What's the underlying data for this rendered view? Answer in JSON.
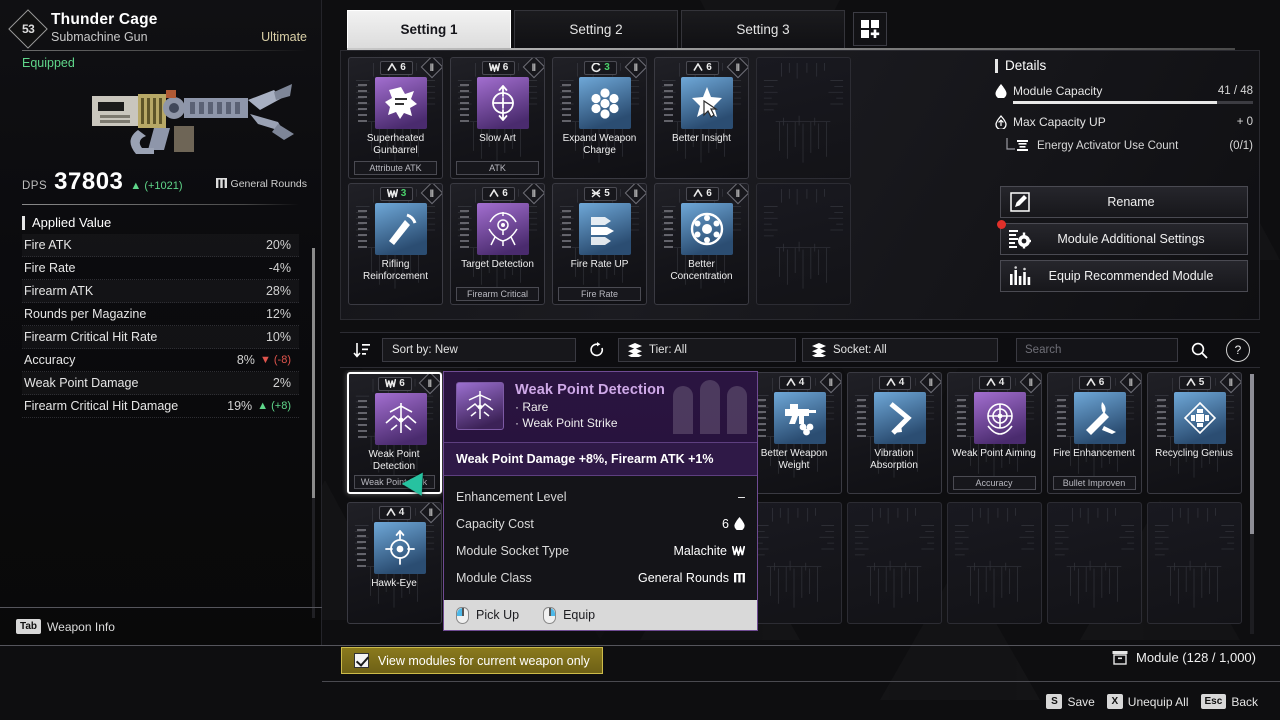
{
  "weapon": {
    "level": "53",
    "name": "Thunder Cage",
    "type": "Submachine Gun",
    "tier": "Ultimate",
    "status": "Equipped",
    "dps_label": "DPS",
    "dps_value": "37803",
    "dps_delta": "▲ (+1021)",
    "round_type": "General Rounds"
  },
  "applied": {
    "header": "Applied Value",
    "rows": [
      {
        "name": "Fire ATK",
        "value": "20%",
        "delta": "",
        "dir": ""
      },
      {
        "name": "Fire Rate",
        "value": "-4%",
        "delta": "",
        "dir": ""
      },
      {
        "name": "Firearm ATK",
        "value": "28%",
        "delta": "",
        "dir": ""
      },
      {
        "name": "Rounds per Magazine",
        "value": "12%",
        "delta": "",
        "dir": ""
      },
      {
        "name": "Firearm Critical Hit Rate",
        "value": "10%",
        "delta": "",
        "dir": ""
      },
      {
        "name": "Accuracy",
        "value": "8%",
        "delta": "▼ (-8)",
        "dir": "down"
      },
      {
        "name": "Weak Point Damage",
        "value": "2%",
        "delta": "",
        "dir": ""
      },
      {
        "name": "Firearm Critical Hit Damage",
        "value": "19%",
        "delta": "▲ (+8)",
        "dir": "up"
      }
    ]
  },
  "left_footer": {
    "key": "Tab",
    "label": "Weapon Info"
  },
  "tabs": {
    "items": [
      {
        "label": "Setting 1",
        "active": true
      },
      {
        "label": "Setting 2",
        "active": false
      },
      {
        "label": "Setting 3",
        "active": false
      }
    ],
    "add_tab_icon": "grid-plus-icon"
  },
  "equipped_modules": [
    {
      "cost": "6",
      "cost_icon": "chevron-socket-icon",
      "name": "Superheated Gunbarrel",
      "tag": "Attribute ATK",
      "icon": "burst-icon",
      "tone": "purple",
      "empty": false
    },
    {
      "cost": "6",
      "cost_icon": "malachite-socket-icon",
      "name": "Slow Art",
      "tag": "ATK",
      "icon": "crosshair-arrows-icon",
      "tone": "purple",
      "empty": false
    },
    {
      "cost": "3",
      "cost_icon": "cerulean-socket-icon",
      "name": "Expand Weapon Charge",
      "tag": "",
      "icon": "cylinder-icon",
      "tone": "blue",
      "empty": false,
      "cost_green": true
    },
    {
      "cost": "6",
      "cost_icon": "chevron-socket-icon",
      "name": "Better Insight",
      "tag": "",
      "icon": "star-cursor-icon",
      "tone": "blue",
      "empty": false
    },
    {
      "cost": "",
      "cost_icon": "",
      "name": "",
      "tag": "",
      "icon": "",
      "tone": "",
      "empty": true
    },
    {
      "cost": "3",
      "cost_icon": "malachite-socket-icon",
      "name": "Rifling Reinforcement",
      "tag": "",
      "icon": "bullet-streak-icon",
      "tone": "blue",
      "empty": false,
      "cost_green": true
    },
    {
      "cost": "6",
      "cost_icon": "chevron-socket-icon",
      "name": "Target Detection",
      "tag": "Firearm Critical",
      "icon": "target-emblem-icon",
      "tone": "purple",
      "empty": false
    },
    {
      "cost": "5",
      "cost_icon": "xantic-socket-icon",
      "name": "Fire Rate UP",
      "tag": "Fire Rate",
      "icon": "bullets-icon",
      "tone": "blue",
      "empty": false
    },
    {
      "cost": "6",
      "cost_icon": "chevron-socket-icon",
      "name": "Better Concentration",
      "tag": "",
      "icon": "gear-wheel-icon",
      "tone": "blue",
      "empty": false
    },
    {
      "cost": "",
      "cost_icon": "",
      "name": "",
      "tag": "",
      "icon": "",
      "tone": "",
      "empty": true
    }
  ],
  "details": {
    "header": "Details",
    "module_capacity_label": "Module Capacity",
    "module_capacity_value": "41 / 48",
    "module_capacity_pct": 85,
    "max_capacity_label": "Max Capacity UP",
    "max_capacity_value": "+ 0",
    "energy_activator_label": "Energy Activator Use Count",
    "energy_activator_value": "(0/1)",
    "buttons": [
      {
        "label": "Rename",
        "icon": "pencil-icon",
        "alert": false
      },
      {
        "label": "Module Additional Settings",
        "icon": "settings-gear-icon",
        "alert": true
      },
      {
        "label": "Equip Recommended Module",
        "icon": "bar-chart-icon",
        "alert": false
      }
    ]
  },
  "filterbar": {
    "sort_icon": "sort-descending-icon",
    "sort_label": "Sort by: New",
    "reset_icon": "refresh-icon",
    "tier_label": "Tier: All",
    "socket_label": "Socket: All",
    "search_placeholder": "Search",
    "search_value": "",
    "search_icon": "magnifier-icon",
    "help_label": "?"
  },
  "inventory": [
    {
      "cost": "6",
      "name": "Weak Point Detection",
      "tag": "Weak Point Strik",
      "tone": "purple",
      "icon": "weakpoint-icon",
      "selected": true,
      "empty": false
    },
    {
      "cost": "4",
      "name": "Better Weapon Weight",
      "tag": "",
      "tone": "blue",
      "icon": "smg-weight-icon",
      "selected": false,
      "empty": false
    },
    {
      "cost": "4",
      "name": "Vibration Absorption",
      "tag": "",
      "tone": "blue",
      "icon": "chevron-arrow-icon",
      "selected": false,
      "empty": false
    },
    {
      "cost": "4",
      "name": "Weak Point Aiming",
      "tag": "Accuracy",
      "tone": "purple",
      "icon": "scope-icon",
      "selected": false,
      "empty": false
    },
    {
      "cost": "6",
      "name": "Fire Enhancement",
      "tag": "Bullet Improven",
      "tone": "blue",
      "icon": "flame-bolt-icon",
      "selected": false,
      "empty": false
    },
    {
      "cost": "5",
      "name": "Recycling Genius",
      "tag": "",
      "tone": "blue",
      "icon": "recycle-icon",
      "selected": false,
      "empty": false
    },
    {
      "cost": "4",
      "name": "Hawk-Eye",
      "tag": "",
      "tone": "blue",
      "icon": "hawkeye-icon",
      "selected": false,
      "empty": false
    }
  ],
  "tooltip": {
    "title": "Weak Point Detection",
    "rarity": "Rare",
    "category": "Weak Point Strike",
    "effect": "Weak Point Damage +8%, Firearm ATK +1%",
    "rows": [
      {
        "label": "Enhancement Level",
        "value": "–"
      },
      {
        "label": "Capacity Cost",
        "value": "6",
        "icon": "drop-icon"
      },
      {
        "label": "Module Socket Type",
        "value": "Malachite",
        "icon": "malachite-icon"
      },
      {
        "label": "Module Class",
        "value": "General Rounds",
        "icon": "general-rounds-icon"
      }
    ],
    "actions": [
      {
        "label": "Pick Up",
        "button": "left"
      },
      {
        "label": "Equip",
        "button": "right"
      }
    ]
  },
  "bottom": {
    "checkbox_label": "View modules for current weapon only",
    "checkbox_checked": true,
    "module_count": "Module (128 / 1,000)",
    "module_icon": "box-icon",
    "hints": [
      {
        "key": "S",
        "label": "Save"
      },
      {
        "key": "X",
        "label": "Unequip All"
      },
      {
        "key": "Esc",
        "label": "Back"
      }
    ]
  },
  "colors": {
    "accent_purple": "#cfa9e8",
    "green": "#5fd68a",
    "red": "#e0544d",
    "yellow": "#cdbb4a",
    "cursor": "#27c2a0"
  }
}
